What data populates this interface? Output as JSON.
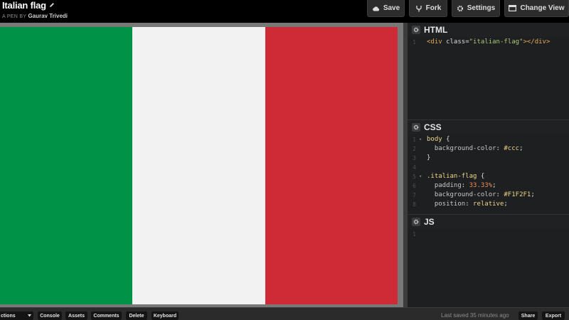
{
  "header": {
    "title": "Italian flag",
    "by_label": "A PEN BY",
    "author": "Gaurav Trivedi",
    "buttons": {
      "save": "Save",
      "fork": "Fork",
      "settings": "Settings",
      "change_view": "Change View"
    }
  },
  "preview": {
    "stripes": [
      {
        "name": "green",
        "color": "#009246"
      },
      {
        "name": "white",
        "color": "#F1F2F1"
      },
      {
        "name": "red",
        "color": "#CE2B37"
      }
    ]
  },
  "editors": {
    "html": {
      "name": "HTML",
      "lines": [
        {
          "n": "1",
          "parts": [
            {
              "t": "<div ",
              "c": "t-tag"
            },
            {
              "t": "class",
              "c": "t-attr"
            },
            {
              "t": "=",
              "c": "t-pun"
            },
            {
              "t": "\"italian-flag\"",
              "c": "t-str"
            },
            {
              "t": "></div>",
              "c": "t-tag"
            }
          ]
        }
      ]
    },
    "css": {
      "name": "CSS",
      "lines": [
        {
          "n": "1",
          "fold": true,
          "parts": [
            {
              "t": "body",
              "c": "t-sel"
            },
            {
              "t": " {",
              "c": "t-pun"
            }
          ]
        },
        {
          "n": "2",
          "parts": [
            {
              "t": "  background-color",
              "c": "t-prop"
            },
            {
              "t": ": ",
              "c": "t-pun"
            },
            {
              "t": "#ccc",
              "c": "t-val"
            },
            {
              "t": ";",
              "c": "t-pun"
            }
          ]
        },
        {
          "n": "3",
          "parts": [
            {
              "t": "}",
              "c": "t-pun"
            }
          ]
        },
        {
          "n": "4",
          "parts": []
        },
        {
          "n": "5",
          "fold": true,
          "parts": [
            {
              "t": ".italian-flag",
              "c": "t-sel"
            },
            {
              "t": " {",
              "c": "t-pun"
            }
          ]
        },
        {
          "n": "6",
          "parts": [
            {
              "t": "  padding",
              "c": "t-prop"
            },
            {
              "t": ": ",
              "c": "t-pun"
            },
            {
              "t": "33.33%",
              "c": "t-num"
            },
            {
              "t": ";",
              "c": "t-pun"
            }
          ]
        },
        {
          "n": "7",
          "parts": [
            {
              "t": "  background-color",
              "c": "t-prop"
            },
            {
              "t": ": ",
              "c": "t-pun"
            },
            {
              "t": "#F1F2F1",
              "c": "t-val"
            },
            {
              "t": ";",
              "c": "t-pun"
            }
          ]
        },
        {
          "n": "8",
          "parts": [
            {
              "t": "  position",
              "c": "t-prop"
            },
            {
              "t": ": ",
              "c": "t-pun"
            },
            {
              "t": "relative",
              "c": "t-val"
            },
            {
              "t": ";",
              "c": "t-pun"
            }
          ]
        }
      ]
    },
    "js": {
      "name": "JS",
      "lines": [
        {
          "n": "1",
          "parts": []
        }
      ]
    }
  },
  "footer": {
    "collections": "ctions",
    "console": "Console",
    "assets": "Assets",
    "comments": "Comments",
    "delete": "Delete",
    "keyboard": "Keyboard",
    "last_saved": "Last saved 35 minutes ago",
    "share": "Share",
    "export": "Export"
  }
}
